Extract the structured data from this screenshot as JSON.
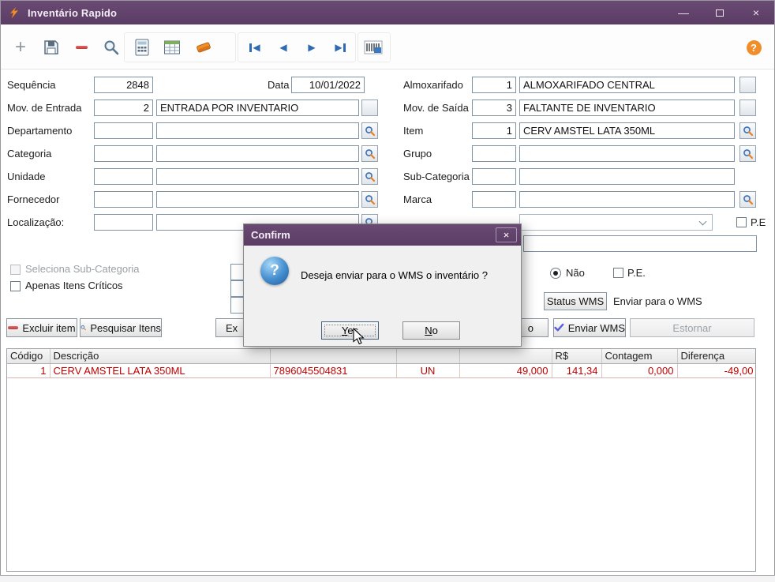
{
  "window": {
    "title": "Inventário Rapido",
    "min_glyph": "—",
    "close_glyph": "×"
  },
  "toolbar": {
    "plus_glyph": "+",
    "prev_glyph": "◀",
    "next_glyph": "▶",
    "help_glyph": "?"
  },
  "form": {
    "sequencia": {
      "label": "Sequência",
      "value": "2848"
    },
    "data": {
      "label": "Data",
      "value": "10/01/2022"
    },
    "almoxarifado": {
      "label": "Almoxarifado",
      "code": "1",
      "desc": "ALMOXARIFADO CENTRAL"
    },
    "mov_entrada": {
      "label": "Mov. de Entrada",
      "code": "2",
      "desc": "ENTRADA POR INVENTARIO"
    },
    "mov_saida": {
      "label": "Mov. de Saída",
      "code": "3",
      "desc": "FALTANTE DE INVENTARIO"
    },
    "departamento": {
      "label": "Departamento",
      "code": "",
      "desc": ""
    },
    "item": {
      "label": "Item",
      "code": "1",
      "desc": "CERV AMSTEL LATA 350ML"
    },
    "categoria": {
      "label": "Categoria",
      "code": "",
      "desc": ""
    },
    "grupo": {
      "label": "Grupo",
      "code": "",
      "desc": ""
    },
    "unidade": {
      "label": "Unidade",
      "code": "",
      "desc": ""
    },
    "sub_categoria": {
      "label": "Sub-Categoria",
      "code": "",
      "desc": ""
    },
    "fornecedor": {
      "label": "Fornecedor",
      "code": "",
      "desc": ""
    },
    "marca": {
      "label": "Marca",
      "code": "",
      "desc": ""
    },
    "localizacao": {
      "label": "Localização:",
      "code": "",
      "desc": ""
    },
    "combo_value": "",
    "pe_top_label": "P.E",
    "seleciona_sub_categoria": "Seleciona Sub-Categoria",
    "apenas_itens_criticos": "Apenas Itens Críticos",
    "radio_nao": "Não",
    "pe_label": "P.E.",
    "status_wms": "Status WMS",
    "enviar_para_wms": "Enviar para o WMS"
  },
  "actions": {
    "excluir_item": "Excluir item",
    "pesquisar_itens": "Pesquisar Itens",
    "partial_left": "Ex",
    "partial_right": "o",
    "enviar_wms": "Enviar WMS",
    "estornar": "Estornar"
  },
  "grid": {
    "columns": [
      "Código",
      "Descrição",
      "",
      "",
      "",
      "R$",
      "Contagem",
      "Diferença"
    ],
    "rows": [
      [
        "1",
        "CERV AMSTEL LATA 350ML",
        "7896045504831",
        "UN",
        "49,000",
        "141,34",
        "0,000",
        "-49,00"
      ]
    ]
  },
  "dialog": {
    "title": "Confirm",
    "close_glyph": "×",
    "icon_glyph": "?",
    "message": "Deseja enviar para o WMS o inventário ?",
    "yes_label": "Yes",
    "no_label": "No"
  },
  "colors": {
    "titlebar_purple": "#5b3a64",
    "accent_orange": "#e8821e",
    "grid_row_red": "#c00000"
  }
}
